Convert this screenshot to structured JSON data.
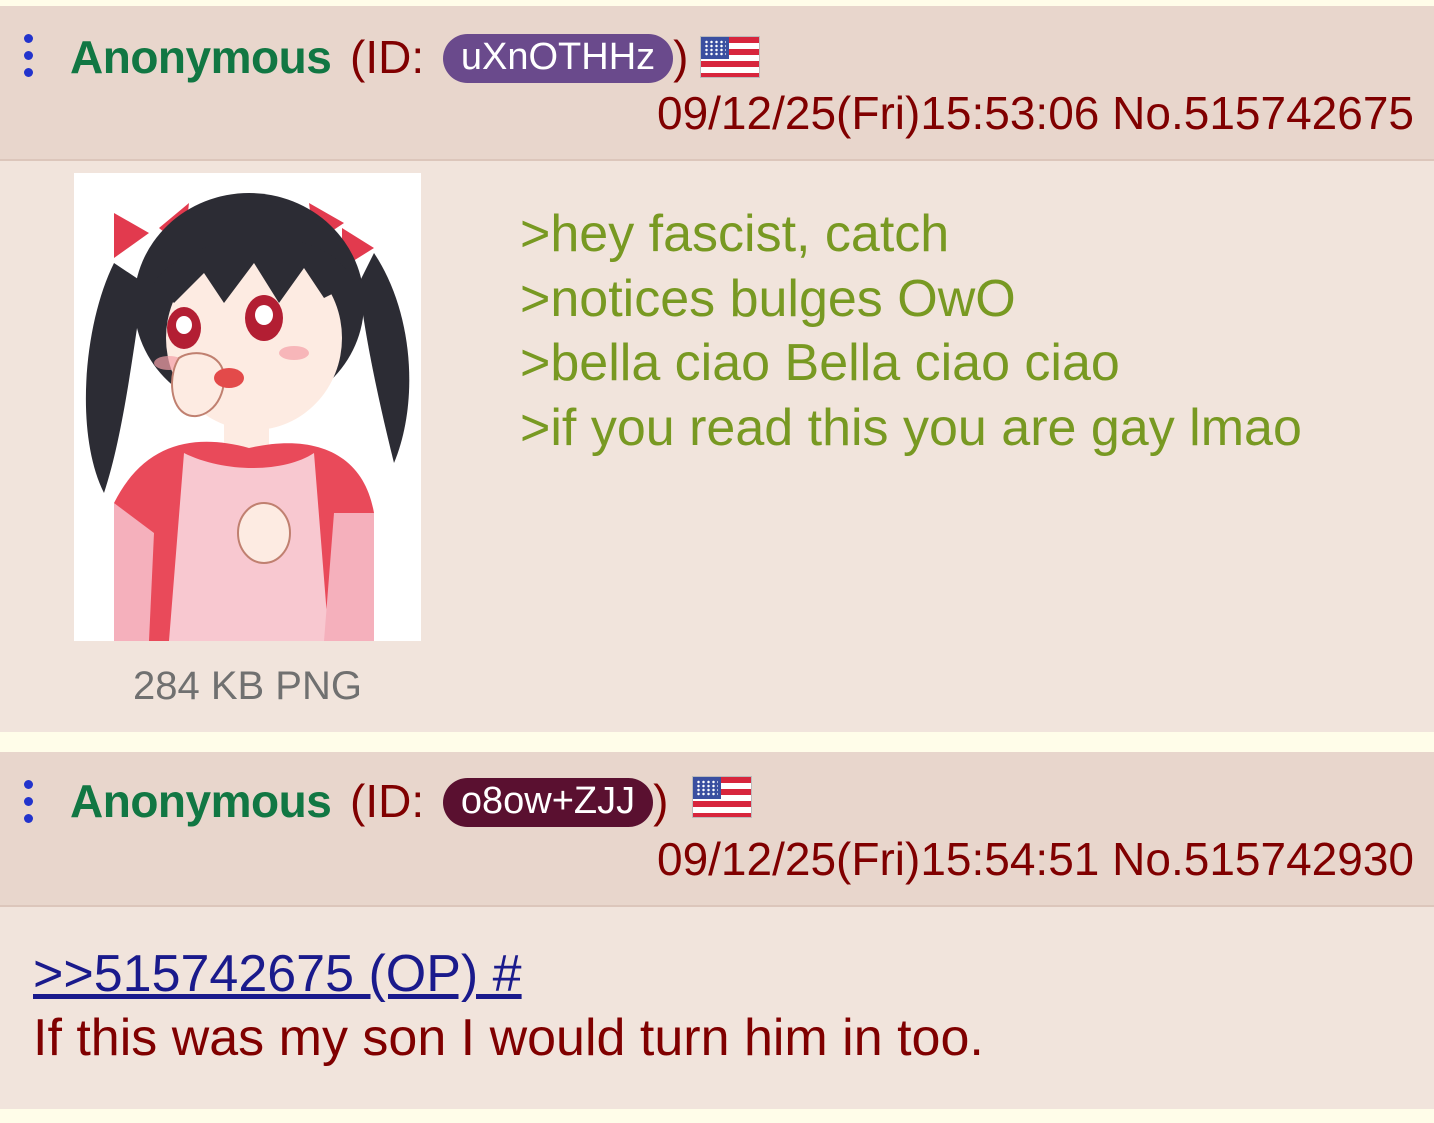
{
  "posts": [
    {
      "name": "Anonymous",
      "id_prefix": "(ID:",
      "id": "uXnOTHHz",
      "id_suffix": ")",
      "flag": "us-flag-icon",
      "datetime": "09/12/25(Fri)15:53:06 No.515742675",
      "file_info": "284 KB PNG",
      "greentext": [
        ">hey fascist, catch",
        ">notices bulges OwO",
        ">bella ciao Bella ciao ciao",
        ">if you read this you are gay lmao"
      ],
      "id_color": "#6a4a8c"
    },
    {
      "name": "Anonymous",
      "id_prefix": "(ID:",
      "id": "o8ow+ZJJ",
      "id_suffix": ")",
      "flag": "us-flag-icon",
      "datetime": "09/12/25(Fri)15:54:51 No.515742930",
      "quote_link": ">>515742675 (OP) #",
      "text": "If this was my son I would turn him in too.",
      "id_color": "#5a1030"
    }
  ],
  "colors": {
    "name": "#117743",
    "meta": "#800000",
    "greentext": "#789922",
    "link": "#1a1a8c",
    "post_bg": "#f1e4dc",
    "header_bg": "#e8d6cc",
    "menu_dots": "#2233cc"
  },
  "icons": [
    "menu-dots-icon",
    "us-flag-icon"
  ]
}
